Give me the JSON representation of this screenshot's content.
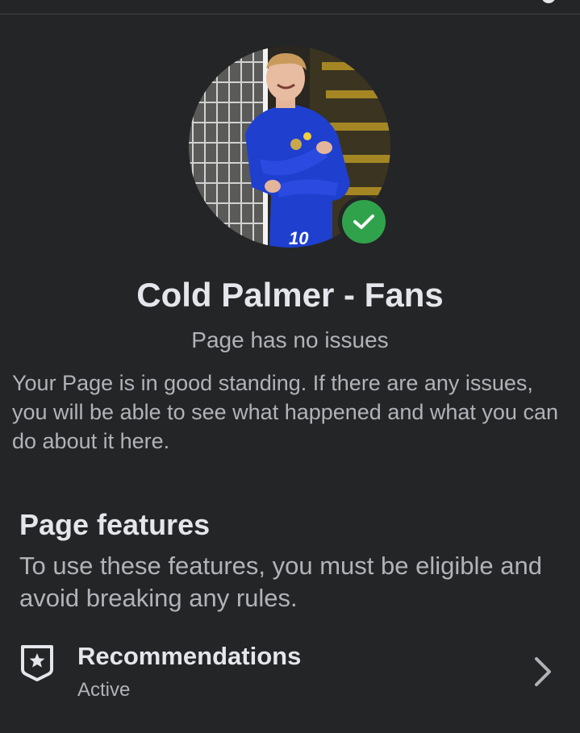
{
  "page": {
    "name": "Cold Palmer - Fans",
    "status": "Page has no issues",
    "standing_text": "Your Page is in good standing. If there are any issues, you will be able to see what happened and what you can do about it here."
  },
  "avatar": {
    "shirt_number": "10"
  },
  "features": {
    "title": "Page features",
    "description": "To use these features, you must be eligible and avoid breaking any rules.",
    "items": [
      {
        "label": "Recommendations",
        "status": "Active",
        "icon": "shield-star-icon"
      }
    ]
  },
  "colors": {
    "background": "#242526",
    "primary_text": "#e4e6eb",
    "secondary_text": "#b0b3b8",
    "verified_green": "#31a24c"
  }
}
